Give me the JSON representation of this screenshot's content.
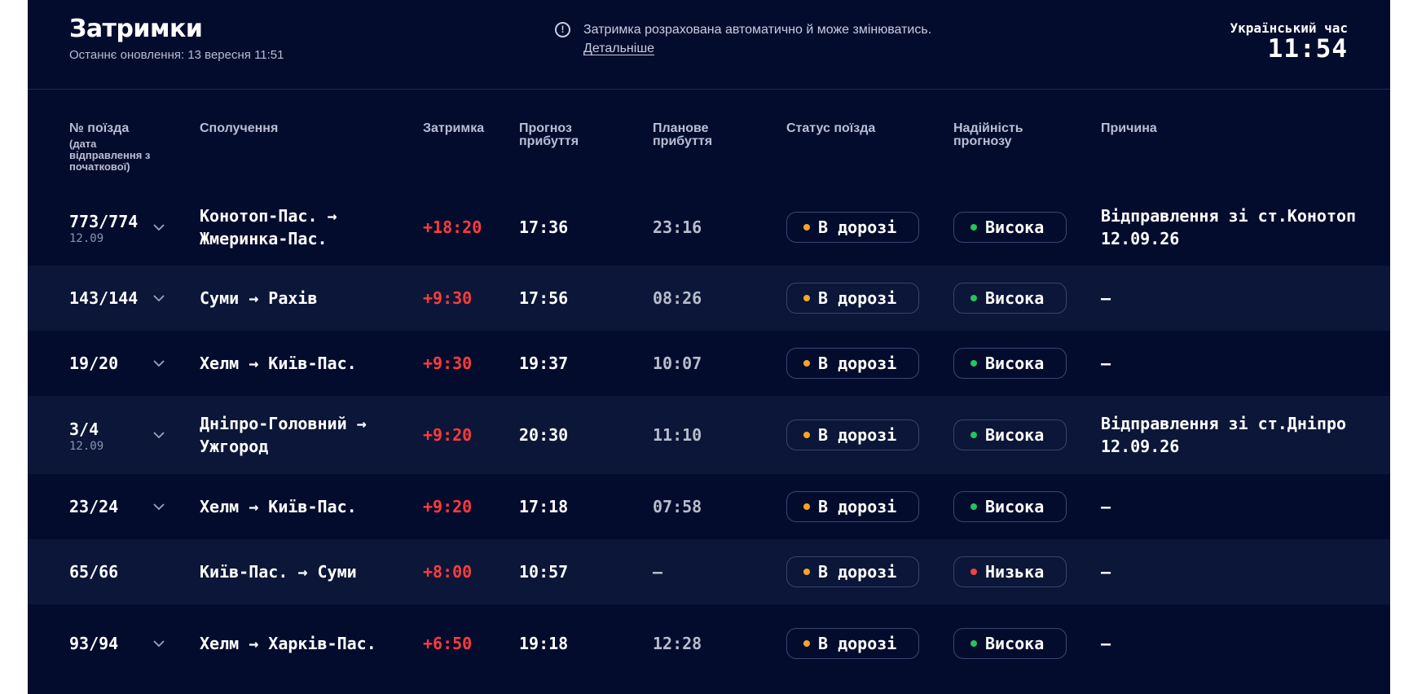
{
  "header": {
    "title": "Затримки",
    "updated": "Останнє оновлення: 13 вересня 11:51",
    "notice_icon": "info-circle-icon",
    "notice_text": "Затримка розрахована автоматично й може змінюватись.",
    "notice_link": "Детальніше",
    "clock_label": "Український час",
    "clock_time": "11:54"
  },
  "colors": {
    "background": "#040c2e",
    "row_alt": "#0b1638",
    "delay": "#ff3b3b",
    "status_dot": "#f5a623",
    "high_dot": "#22c55e",
    "low_dot": "#ef4444"
  },
  "table": {
    "headers": {
      "train_no": "№ поїзда",
      "train_no_sub": "(дата відправлення з початкової)",
      "route": "Сполучення",
      "delay": "Затримка",
      "forecast": "Прогноз прибуття",
      "planned": "Планове прибуття",
      "status": "Статус поїзда",
      "reliability": "Надійність прогнозу",
      "reason": "Причина"
    },
    "rows": [
      {
        "train": "773/774",
        "date": "12.09",
        "expand": true,
        "route_from": "Конотоп-Пас.",
        "route_to": "Жмеринка-Пас.",
        "delay": "+18:20",
        "forecast": "17:36",
        "planned": "23:16",
        "status": "В дорозі",
        "reliability": "Висока",
        "reliability_level": "high",
        "reason": "Відправлення зі ст.Конотоп 12.09.26"
      },
      {
        "train": "143/144",
        "date": "",
        "expand": true,
        "route_from": "Суми",
        "route_to": "Рахів",
        "delay": "+9:30",
        "forecast": "17:56",
        "planned": "08:26",
        "status": "В дорозі",
        "reliability": "Висока",
        "reliability_level": "high",
        "reason": "—"
      },
      {
        "train": "19/20",
        "date": "",
        "expand": true,
        "route_from": "Хелм",
        "route_to": "Київ-Пас.",
        "delay": "+9:30",
        "forecast": "19:37",
        "planned": "10:07",
        "status": "В дорозі",
        "reliability": "Висока",
        "reliability_level": "high",
        "reason": "—"
      },
      {
        "train": "3/4",
        "date": "12.09",
        "expand": true,
        "route_from": "Дніпро-Головний",
        "route_to": "Ужгород",
        "delay": "+9:20",
        "forecast": "20:30",
        "planned": "11:10",
        "status": "В дорозі",
        "reliability": "Висока",
        "reliability_level": "high",
        "reason": "Відправлення зі ст.Дніпро 12.09.26"
      },
      {
        "train": "23/24",
        "date": "",
        "expand": true,
        "route_from": "Хелм",
        "route_to": "Київ-Пас.",
        "delay": "+9:20",
        "forecast": "17:18",
        "planned": "07:58",
        "status": "В дорозі",
        "reliability": "Висока",
        "reliability_level": "high",
        "reason": "—"
      },
      {
        "train": "65/66",
        "date": "",
        "expand": false,
        "route_from": "Київ-Пас.",
        "route_to": "Суми",
        "delay": "+8:00",
        "forecast": "10:57",
        "planned": "—",
        "status": "В дорозі",
        "reliability": "Низька",
        "reliability_level": "low",
        "reason": "—"
      },
      {
        "train": "93/94",
        "date": "",
        "expand": true,
        "route_from": "Хелм",
        "route_to": "Харків-Пас.",
        "delay": "+6:50",
        "forecast": "19:18",
        "planned": "12:28",
        "status": "В дорозі",
        "reliability": "Висока",
        "reliability_level": "high",
        "reason": "—"
      }
    ]
  }
}
